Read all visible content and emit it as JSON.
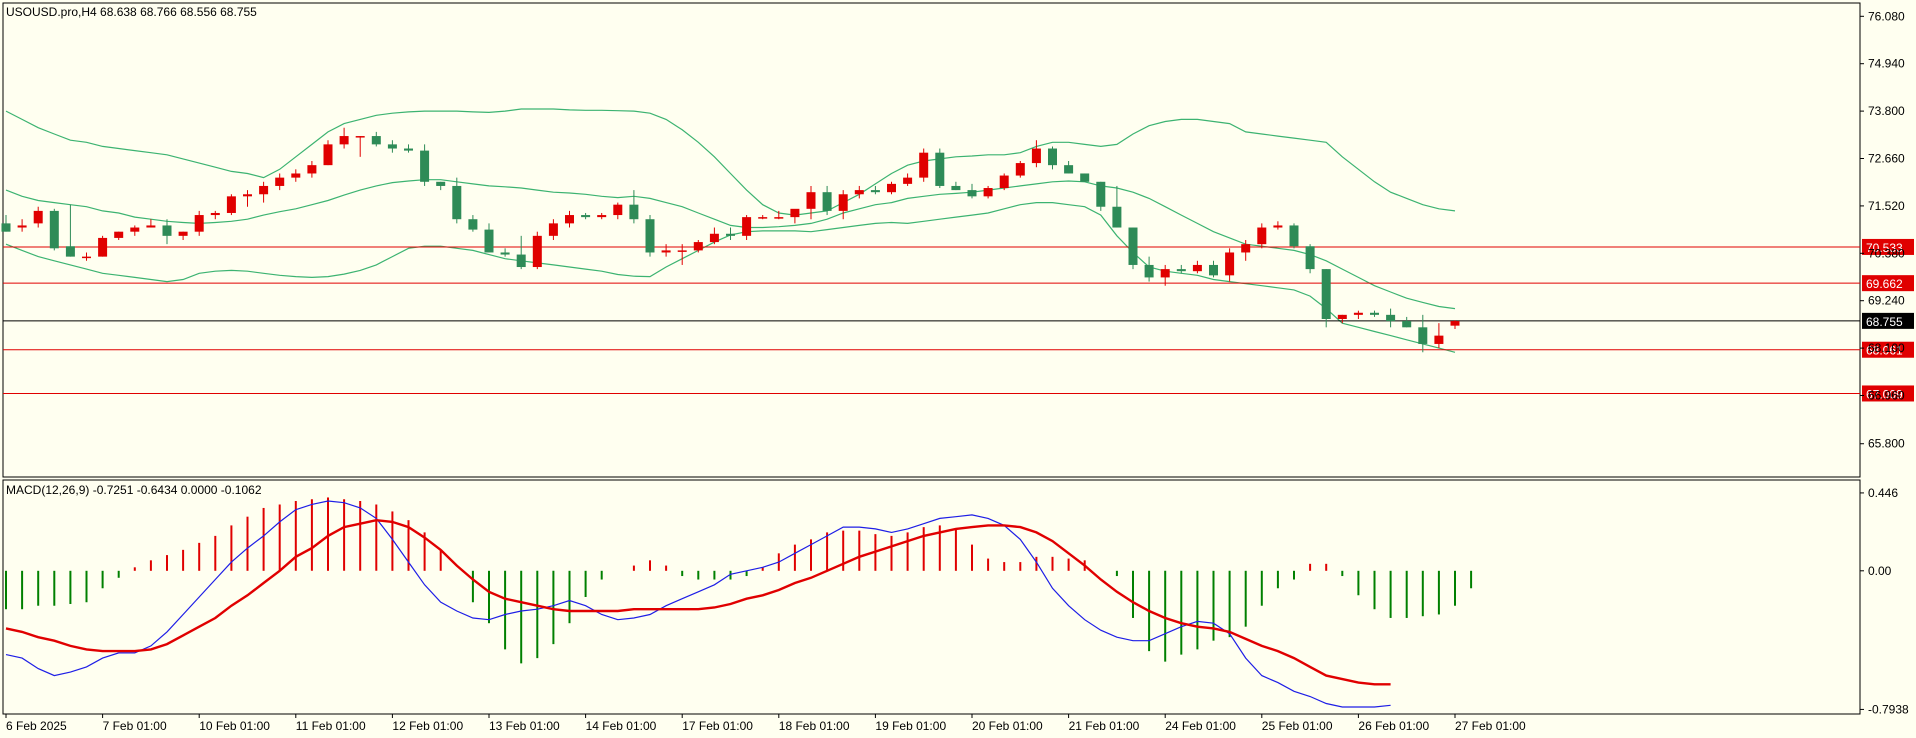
{
  "chart_data": [
    {
      "type": "candlestick",
      "title": "USOUSD.pro,H4  68.638 68.766 68.556 68.755",
      "ylim": [
        65.0,
        76.4
      ],
      "yticks": [
        "76.080",
        "74.940",
        "73.800",
        "72.660",
        "71.520",
        "70.380",
        "69.240",
        "68.100",
        "66.960",
        "65.800"
      ],
      "xticks": [
        "6 Feb 2025",
        "7 Feb 01:00",
        "10 Feb 01:00",
        "11 Feb 01:00",
        "12 Feb 01:00",
        "13 Feb 01:00",
        "14 Feb 01:00",
        "17 Feb 01:00",
        "18 Feb 01:00",
        "19 Feb 01:00",
        "20 Feb 01:00",
        "21 Feb 01:00",
        "24 Feb 01:00",
        "25 Feb 01:00",
        "26 Feb 01:00",
        "27 Feb 01:00"
      ],
      "current_price": {
        "value": 68.755,
        "label": "68.755"
      },
      "levels": [
        {
          "value": 70.533,
          "label": "70.533"
        },
        {
          "value": 69.662,
          "label": "69.662"
        },
        {
          "value": 68.061,
          "label": "68.061"
        },
        {
          "value": 67.009,
          "label": "67.009"
        }
      ],
      "ohlc": [
        [
          71.1,
          71.3,
          70.9,
          70.9
        ],
        [
          71.0,
          71.2,
          70.9,
          71.05
        ],
        [
          71.1,
          71.5,
          71.0,
          71.4
        ],
        [
          71.4,
          71.45,
          70.45,
          70.5
        ],
        [
          70.55,
          71.55,
          70.3,
          70.3
        ],
        [
          70.3,
          70.4,
          70.2,
          70.3
        ],
        [
          70.3,
          70.8,
          70.3,
          70.75
        ],
        [
          70.75,
          70.9,
          70.7,
          70.9
        ],
        [
          70.9,
          71.05,
          70.8,
          71.0
        ],
        [
          71.0,
          71.2,
          71.0,
          71.05
        ],
        [
          71.05,
          71.2,
          70.6,
          70.8
        ],
        [
          70.8,
          70.9,
          70.7,
          70.9
        ],
        [
          70.9,
          71.4,
          70.8,
          71.3
        ],
        [
          71.3,
          71.4,
          71.2,
          71.35
        ],
        [
          71.35,
          71.8,
          71.3,
          71.75
        ],
        [
          71.75,
          71.9,
          71.5,
          71.8
        ],
        [
          71.8,
          72.1,
          71.6,
          72.0
        ],
        [
          72.0,
          72.3,
          71.9,
          72.2
        ],
        [
          72.2,
          72.4,
          72.1,
          72.3
        ],
        [
          72.3,
          72.6,
          72.2,
          72.5
        ],
        [
          72.5,
          73.1,
          72.5,
          73.0
        ],
        [
          73.0,
          73.4,
          72.9,
          73.2
        ],
        [
          73.2,
          73.2,
          72.7,
          73.2
        ],
        [
          73.2,
          73.3,
          72.95,
          73.0
        ],
        [
          73.0,
          73.1,
          72.8,
          72.9
        ],
        [
          72.9,
          73.0,
          72.8,
          72.85
        ],
        [
          72.85,
          73.0,
          72.0,
          72.1
        ],
        [
          72.1,
          72.1,
          71.9,
          72.0
        ],
        [
          72.0,
          72.2,
          71.1,
          71.2
        ],
        [
          71.2,
          71.3,
          70.9,
          70.95
        ],
        [
          70.95,
          71.1,
          70.4,
          70.4
        ],
        [
          70.4,
          70.5,
          70.3,
          70.35
        ],
        [
          70.35,
          70.8,
          70.0,
          70.05
        ],
        [
          70.05,
          70.9,
          70.0,
          70.8
        ],
        [
          70.8,
          71.2,
          70.7,
          71.1
        ],
        [
          71.1,
          71.4,
          71.0,
          71.3
        ],
        [
          71.3,
          71.35,
          71.2,
          71.25
        ],
        [
          71.25,
          71.35,
          71.2,
          71.3
        ],
        [
          71.3,
          71.6,
          71.2,
          71.55
        ],
        [
          71.55,
          71.9,
          71.1,
          71.2
        ],
        [
          71.2,
          71.3,
          70.3,
          70.4
        ],
        [
          70.4,
          70.6,
          70.3,
          70.45
        ],
        [
          70.45,
          70.6,
          70.1,
          70.45
        ],
        [
          70.45,
          70.7,
          70.4,
          70.65
        ],
        [
          70.65,
          71.0,
          70.6,
          70.85
        ],
        [
          70.85,
          71.0,
          70.7,
          70.8
        ],
        [
          70.8,
          71.3,
          70.7,
          71.25
        ],
        [
          71.25,
          71.3,
          71.2,
          71.25
        ],
        [
          71.25,
          71.4,
          71.2,
          71.25
        ],
        [
          71.25,
          71.4,
          71.1,
          71.45
        ],
        [
          71.45,
          72.0,
          71.2,
          71.85
        ],
        [
          71.85,
          72.0,
          71.3,
          71.4
        ],
        [
          71.4,
          71.9,
          71.2,
          71.8
        ],
        [
          71.8,
          72.0,
          71.7,
          71.9
        ],
        [
          71.9,
          72.0,
          71.8,
          71.85
        ],
        [
          71.85,
          72.1,
          71.8,
          72.05
        ],
        [
          72.05,
          72.3,
          72.0,
          72.2
        ],
        [
          72.2,
          72.9,
          72.1,
          72.8
        ],
        [
          72.8,
          72.9,
          71.95,
          72.0
        ],
        [
          72.0,
          72.1,
          71.9,
          71.9
        ],
        [
          71.9,
          72.05,
          71.7,
          71.75
        ],
        [
          71.75,
          72.0,
          71.7,
          71.95
        ],
        [
          71.95,
          72.3,
          71.9,
          72.25
        ],
        [
          72.25,
          72.6,
          72.2,
          72.55
        ],
        [
          72.55,
          73.1,
          72.45,
          72.9
        ],
        [
          72.9,
          72.95,
          72.4,
          72.5
        ],
        [
          72.5,
          72.6,
          72.3,
          72.3
        ],
        [
          72.3,
          72.3,
          72.1,
          72.1
        ],
        [
          72.1,
          72.1,
          71.4,
          71.5
        ],
        [
          71.5,
          72.0,
          71.0,
          71.0
        ],
        [
          71.0,
          71.0,
          70.0,
          70.1
        ],
        [
          70.1,
          70.3,
          69.7,
          69.8
        ],
        [
          69.8,
          70.1,
          69.6,
          70.0
        ],
        [
          70.0,
          70.1,
          69.9,
          69.95
        ],
        [
          69.95,
          70.2,
          69.9,
          70.1
        ],
        [
          70.1,
          70.2,
          69.8,
          69.85
        ],
        [
          69.85,
          70.5,
          69.7,
          70.4
        ],
        [
          70.4,
          70.7,
          70.2,
          70.6
        ],
        [
          70.6,
          71.1,
          70.5,
          71.0
        ],
        [
          71.0,
          71.15,
          70.95,
          71.05
        ],
        [
          71.05,
          71.1,
          70.5,
          70.55
        ],
        [
          70.55,
          70.6,
          69.9,
          70.0
        ],
        [
          70.0,
          70.0,
          68.6,
          68.8
        ],
        [
          68.8,
          68.9,
          68.7,
          68.9
        ],
        [
          68.9,
          69.0,
          68.8,
          68.95
        ],
        [
          68.95,
          69.0,
          68.85,
          68.9
        ],
        [
          68.9,
          69.05,
          68.6,
          68.75
        ],
        [
          68.75,
          68.85,
          68.6,
          68.6
        ],
        [
          68.6,
          68.9,
          68.0,
          68.2
        ],
        [
          68.2,
          68.7,
          68.1,
          68.4
        ],
        [
          68.64,
          68.77,
          68.56,
          68.75
        ]
      ],
      "bollinger": {
        "upper": [
          73.8,
          73.6,
          73.4,
          73.25,
          73.1,
          73.05,
          72.95,
          72.9,
          72.85,
          72.8,
          72.75,
          72.65,
          72.55,
          72.45,
          72.35,
          72.3,
          72.2,
          72.4,
          72.7,
          73.0,
          73.3,
          73.5,
          73.6,
          73.7,
          73.75,
          73.78,
          73.8,
          73.8,
          73.8,
          73.78,
          73.77,
          73.8,
          73.85,
          73.85,
          73.85,
          73.83,
          73.82,
          73.82,
          73.81,
          73.8,
          73.75,
          73.6,
          73.35,
          73.05,
          72.7,
          72.3,
          71.9,
          71.55,
          71.35,
          71.3,
          71.35,
          71.4,
          71.6,
          71.8,
          72.05,
          72.3,
          72.5,
          72.6,
          72.65,
          72.7,
          72.72,
          72.75,
          72.75,
          72.8,
          72.95,
          73.05,
          73.05,
          73.0,
          72.95,
          73.0,
          73.25,
          73.45,
          73.55,
          73.6,
          73.6,
          73.55,
          73.5,
          73.3,
          73.25,
          73.2,
          73.15,
          73.1,
          73.05,
          72.7,
          72.4,
          72.1,
          71.85,
          71.7,
          71.55,
          71.45,
          71.4
        ],
        "middle": [
          71.9,
          71.75,
          71.65,
          71.6,
          71.55,
          71.5,
          71.4,
          71.35,
          71.25,
          71.2,
          71.15,
          71.12,
          71.1,
          71.12,
          71.15,
          71.2,
          71.3,
          71.38,
          71.45,
          71.55,
          71.65,
          71.78,
          71.9,
          72.0,
          72.08,
          72.12,
          72.15,
          72.15,
          72.1,
          72.05,
          72.0,
          71.98,
          71.95,
          71.9,
          71.85,
          71.83,
          71.8,
          71.75,
          71.72,
          71.75,
          71.7,
          71.6,
          71.5,
          71.35,
          71.2,
          71.05,
          71.0,
          71.0,
          71.02,
          71.05,
          71.1,
          71.2,
          71.35,
          71.45,
          71.55,
          71.6,
          71.7,
          71.75,
          71.8,
          71.82,
          71.85,
          71.9,
          71.95,
          72.0,
          72.05,
          72.1,
          72.12,
          72.1,
          72.0,
          71.95,
          71.85,
          71.7,
          71.5,
          71.3,
          71.1,
          70.9,
          70.75,
          70.6,
          70.55,
          70.5,
          70.45,
          70.35,
          70.2,
          70.0,
          69.8,
          69.6,
          69.45,
          69.3,
          69.2,
          69.1,
          69.05
        ],
        "lower": [
          70.6,
          70.45,
          70.3,
          70.2,
          70.1,
          70.0,
          69.9,
          69.85,
          69.8,
          69.75,
          69.7,
          69.75,
          69.9,
          69.95,
          69.97,
          69.95,
          69.9,
          69.85,
          69.82,
          69.8,
          69.82,
          69.88,
          69.97,
          70.1,
          70.3,
          70.5,
          70.55,
          70.55,
          70.5,
          70.45,
          70.35,
          70.25,
          70.2,
          70.15,
          70.1,
          70.05,
          70.0,
          69.95,
          69.87,
          69.83,
          69.82,
          70.05,
          70.25,
          70.45,
          70.65,
          70.82,
          70.9,
          70.92,
          70.92,
          70.92,
          70.9,
          70.95,
          71.0,
          71.05,
          71.1,
          71.12,
          71.1,
          71.15,
          71.2,
          71.25,
          71.3,
          71.35,
          71.45,
          71.55,
          71.6,
          71.6,
          71.55,
          71.5,
          71.3,
          70.8,
          70.4,
          70.05,
          69.95,
          69.9,
          69.85,
          69.75,
          69.7,
          69.65,
          69.6,
          69.55,
          69.5,
          69.35,
          69.05,
          68.7,
          68.6,
          68.5,
          68.4,
          68.3,
          68.2,
          68.1,
          68.0
        ]
      }
    },
    {
      "type": "macd",
      "title": "MACD(12,26,9) -0.7251 -0.6434 0.0000 -0.1062",
      "ylim": [
        -0.82,
        0.52
      ],
      "yticks": [
        "0.446",
        "0.00",
        "-0.7938"
      ],
      "histogram": [
        -0.22,
        -0.22,
        -0.2,
        -0.2,
        -0.19,
        -0.18,
        -0.1,
        -0.04,
        0.02,
        0.06,
        0.09,
        0.12,
        0.16,
        0.2,
        0.26,
        0.31,
        0.36,
        0.38,
        0.4,
        0.41,
        0.42,
        0.41,
        0.4,
        0.38,
        0.34,
        0.29,
        0.22,
        0.12,
        0.0,
        -0.18,
        -0.3,
        -0.45,
        -0.53,
        -0.5,
        -0.42,
        -0.3,
        -0.15,
        -0.05,
        0.0,
        0.03,
        0.06,
        0.03,
        -0.03,
        -0.05,
        -0.05,
        -0.05,
        -0.03,
        0.02,
        0.1,
        0.15,
        0.18,
        0.22,
        0.23,
        0.23,
        0.21,
        0.2,
        0.22,
        0.25,
        0.26,
        0.24,
        0.15,
        0.07,
        0.05,
        0.05,
        0.08,
        0.08,
        0.07,
        0.06,
        0.0,
        -0.03,
        -0.27,
        -0.46,
        -0.52,
        -0.48,
        -0.45,
        -0.4,
        -0.38,
        -0.32,
        -0.2,
        -0.1,
        -0.05,
        0.04,
        0.04,
        -0.03,
        -0.14,
        -0.22,
        -0.27,
        -0.27,
        -0.26,
        -0.25,
        -0.2,
        -0.1
      ],
      "macd": [
        -0.48,
        -0.5,
        -0.56,
        -0.6,
        -0.58,
        -0.55,
        -0.5,
        -0.47,
        -0.47,
        -0.43,
        -0.35,
        -0.25,
        -0.15,
        -0.05,
        0.05,
        0.13,
        0.2,
        0.28,
        0.35,
        0.38,
        0.4,
        0.39,
        0.36,
        0.3,
        0.18,
        0.05,
        -0.08,
        -0.18,
        -0.23,
        -0.27,
        -0.28,
        -0.25,
        -0.23,
        -0.22,
        -0.2,
        -0.17,
        -0.2,
        -0.25,
        -0.28,
        -0.27,
        -0.25,
        -0.2,
        -0.16,
        -0.12,
        -0.08,
        -0.02,
        0.0,
        0.02,
        0.05,
        0.1,
        0.15,
        0.2,
        0.25,
        0.25,
        0.24,
        0.22,
        0.24,
        0.27,
        0.3,
        0.31,
        0.32,
        0.3,
        0.26,
        0.18,
        0.05,
        -0.1,
        -0.2,
        -0.28,
        -0.34,
        -0.38,
        -0.4,
        -0.4,
        -0.36,
        -0.32,
        -0.29,
        -0.3,
        -0.36,
        -0.5,
        -0.6,
        -0.64,
        -0.69,
        -0.72,
        -0.76,
        -0.78,
        -0.78,
        -0.78,
        -0.77
      ],
      "signal": [
        -0.33,
        -0.35,
        -0.38,
        -0.4,
        -0.43,
        -0.45,
        -0.46,
        -0.46,
        -0.46,
        -0.45,
        -0.42,
        -0.37,
        -0.32,
        -0.27,
        -0.2,
        -0.14,
        -0.07,
        0.0,
        0.08,
        0.13,
        0.2,
        0.25,
        0.27,
        0.29,
        0.28,
        0.25,
        0.19,
        0.12,
        0.03,
        -0.05,
        -0.12,
        -0.16,
        -0.18,
        -0.2,
        -0.22,
        -0.23,
        -0.23,
        -0.23,
        -0.23,
        -0.22,
        -0.22,
        -0.22,
        -0.22,
        -0.22,
        -0.21,
        -0.19,
        -0.16,
        -0.14,
        -0.11,
        -0.07,
        -0.04,
        0.0,
        0.04,
        0.08,
        0.11,
        0.14,
        0.17,
        0.2,
        0.22,
        0.24,
        0.25,
        0.26,
        0.26,
        0.25,
        0.22,
        0.17,
        0.1,
        0.03,
        -0.05,
        -0.12,
        -0.18,
        -0.23,
        -0.27,
        -0.3,
        -0.32,
        -0.33,
        -0.35,
        -0.39,
        -0.43,
        -0.46,
        -0.5,
        -0.55,
        -0.6,
        -0.62,
        -0.64,
        -0.65,
        -0.65
      ]
    }
  ],
  "colors": {
    "background": "#fffff0",
    "bull": "#2e8b57",
    "bear": "#e00000",
    "band": "#3cb371",
    "level": "#e00000",
    "macd_line": "#1e1ee6",
    "signal_line": "#e00000",
    "hist_pos": "#e00000",
    "hist_neg": "#008000",
    "text": "#000000"
  }
}
